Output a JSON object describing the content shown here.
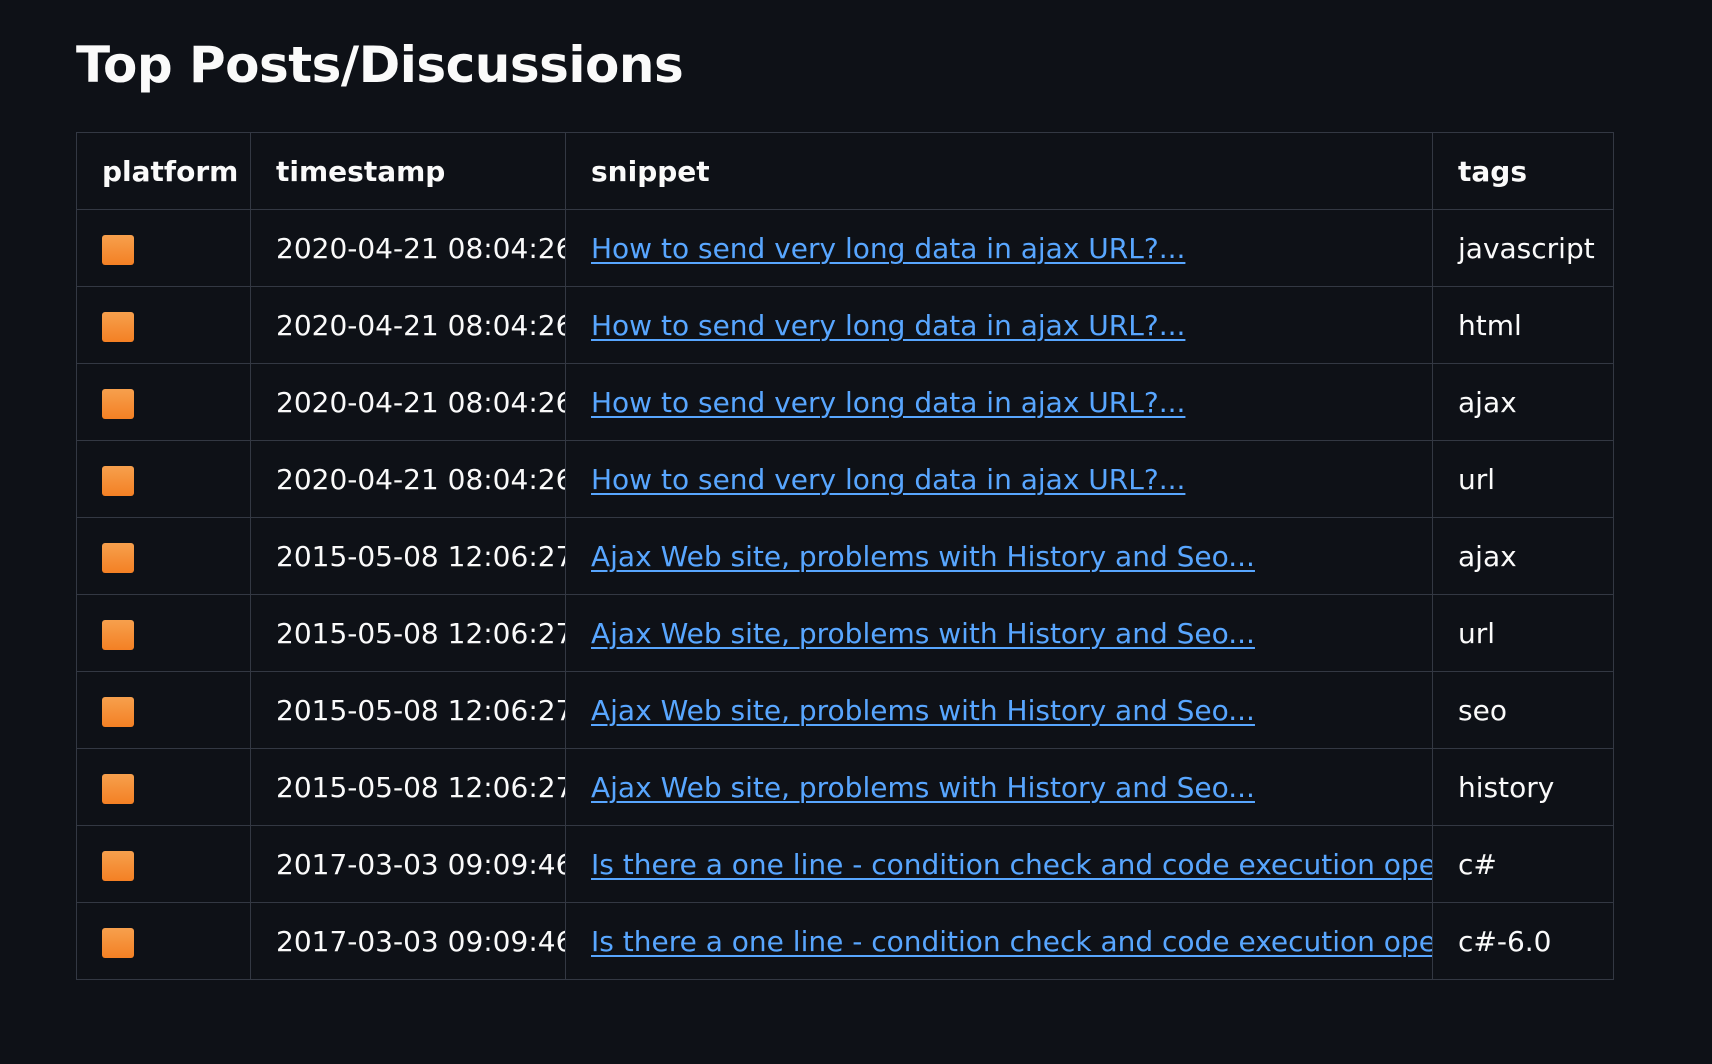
{
  "title": "Top Posts/Discussions",
  "colors": {
    "platform_icon": "#f48024",
    "link": "#58a6ff"
  },
  "columns": {
    "platform": "platform",
    "timestamp": "timestamp",
    "snippet": "snippet",
    "tags": "tags"
  },
  "rows": [
    {
      "platform_icon": "orange-square",
      "timestamp": "2020-04-21 08:04:26",
      "snippet": "How to send very long data in ajax URL?...",
      "tags": "javascript"
    },
    {
      "platform_icon": "orange-square",
      "timestamp": "2020-04-21 08:04:26",
      "snippet": "How to send very long data in ajax URL?...",
      "tags": "html"
    },
    {
      "platform_icon": "orange-square",
      "timestamp": "2020-04-21 08:04:26",
      "snippet": "How to send very long data in ajax URL?...",
      "tags": "ajax"
    },
    {
      "platform_icon": "orange-square",
      "timestamp": "2020-04-21 08:04:26",
      "snippet": "How to send very long data in ajax URL?...",
      "tags": "url"
    },
    {
      "platform_icon": "orange-square",
      "timestamp": "2015-05-08 12:06:27",
      "snippet": "Ajax Web site, problems with History and Seo...",
      "tags": "ajax"
    },
    {
      "platform_icon": "orange-square",
      "timestamp": "2015-05-08 12:06:27",
      "snippet": "Ajax Web site, problems with History and Seo...",
      "tags": "url"
    },
    {
      "platform_icon": "orange-square",
      "timestamp": "2015-05-08 12:06:27",
      "snippet": "Ajax Web site, problems with History and Seo...",
      "tags": "seo"
    },
    {
      "platform_icon": "orange-square",
      "timestamp": "2015-05-08 12:06:27",
      "snippet": "Ajax Web site, problems with History and Seo...",
      "tags": "history"
    },
    {
      "platform_icon": "orange-square",
      "timestamp": "2017-03-03 09:09:46",
      "snippet": "Is there a one line - condition check and code execution ope...",
      "tags": "c#"
    },
    {
      "platform_icon": "orange-square",
      "timestamp": "2017-03-03 09:09:46",
      "snippet": "Is there a one line - condition check and code execution ope...",
      "tags": "c#-6.0"
    }
  ]
}
